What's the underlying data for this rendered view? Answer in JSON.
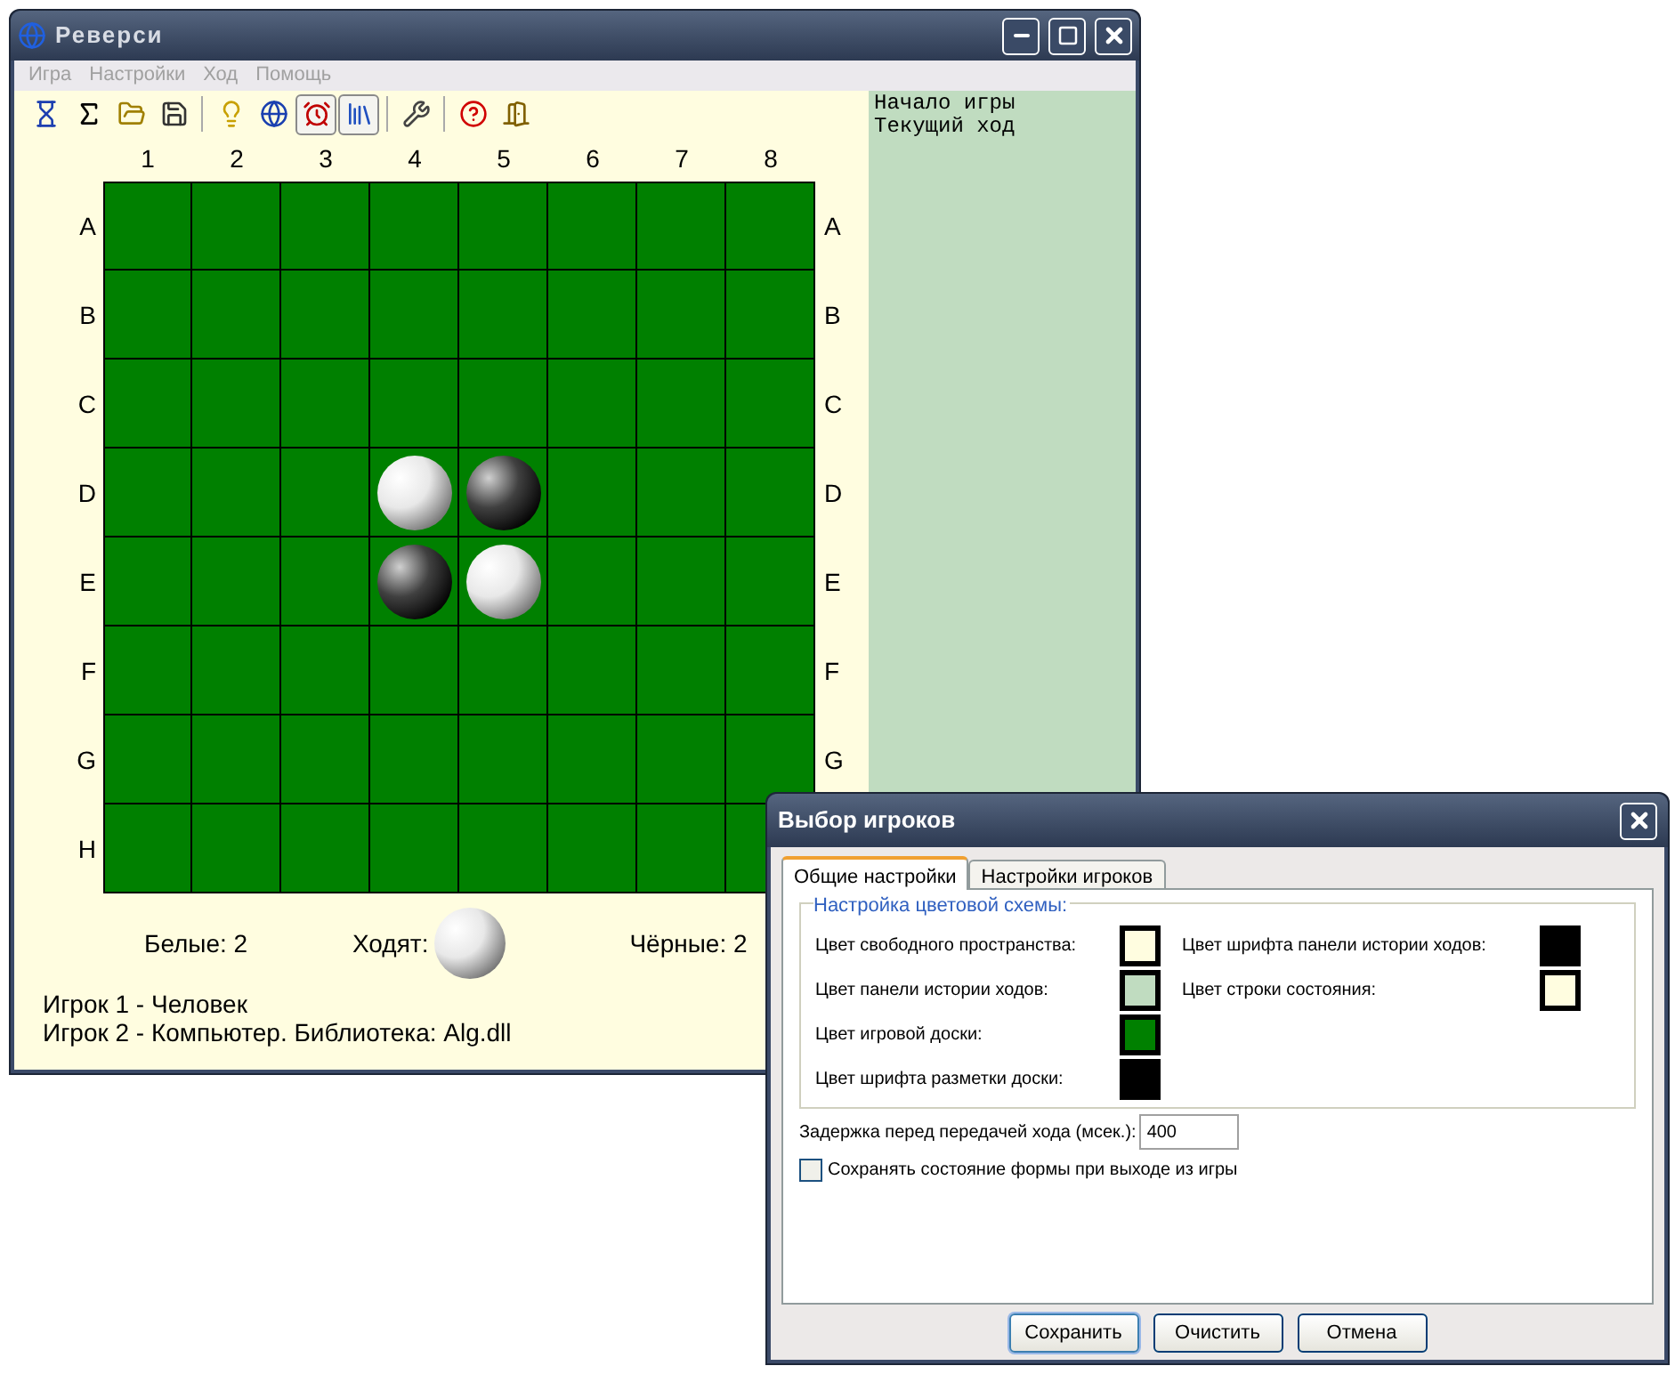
{
  "main_window": {
    "title": "Реверси"
  },
  "menu": [
    {
      "label": "Игра",
      "disabled": true
    },
    {
      "label": "Настройки",
      "disabled": true
    },
    {
      "label": "Ход",
      "disabled": true
    },
    {
      "label": "Помощь",
      "disabled": true
    }
  ],
  "toolbar": [
    {
      "kind": "hourglass",
      "pressed": false
    },
    {
      "kind": "sigma",
      "pressed": false
    },
    {
      "kind": "folder",
      "pressed": false
    },
    {
      "kind": "save",
      "pressed": false
    },
    {
      "kind": "separator"
    },
    {
      "kind": "bulb",
      "pressed": false
    },
    {
      "kind": "globe",
      "pressed": false
    },
    {
      "kind": "alarm",
      "pressed": true
    },
    {
      "kind": "books",
      "pressed": true
    },
    {
      "kind": "separator"
    },
    {
      "kind": "tools",
      "pressed": false
    },
    {
      "kind": "separator"
    },
    {
      "kind": "help",
      "pressed": false
    },
    {
      "kind": "door",
      "pressed": false
    }
  ],
  "board": {
    "columns": [
      "1",
      "2",
      "3",
      "4",
      "5",
      "6",
      "7",
      "8"
    ],
    "rows": [
      {
        "left": "A",
        "right": "A",
        "cells": [
          {
            "kind": "empty"
          },
          {
            "kind": "empty"
          },
          {
            "kind": "empty"
          },
          {
            "kind": "empty"
          },
          {
            "kind": "empty"
          },
          {
            "kind": "empty"
          },
          {
            "kind": "empty"
          },
          {
            "kind": "empty"
          }
        ]
      },
      {
        "left": "B",
        "right": "B",
        "cells": [
          {
            "kind": "empty"
          },
          {
            "kind": "empty"
          },
          {
            "kind": "empty"
          },
          {
            "kind": "empty"
          },
          {
            "kind": "empty"
          },
          {
            "kind": "empty"
          },
          {
            "kind": "empty"
          },
          {
            "kind": "empty"
          }
        ]
      },
      {
        "left": "C",
        "right": "C",
        "cells": [
          {
            "kind": "empty"
          },
          {
            "kind": "empty"
          },
          {
            "kind": "empty"
          },
          {
            "kind": "empty"
          },
          {
            "kind": "empty"
          },
          {
            "kind": "empty"
          },
          {
            "kind": "empty"
          },
          {
            "kind": "empty"
          }
        ]
      },
      {
        "left": "D",
        "right": "D",
        "cells": [
          {
            "kind": "empty"
          },
          {
            "kind": "empty"
          },
          {
            "kind": "empty"
          },
          {
            "kind": "white"
          },
          {
            "kind": "black"
          },
          {
            "kind": "empty"
          },
          {
            "kind": "empty"
          },
          {
            "kind": "empty"
          }
        ]
      },
      {
        "left": "E",
        "right": "E",
        "cells": [
          {
            "kind": "empty"
          },
          {
            "kind": "empty"
          },
          {
            "kind": "empty"
          },
          {
            "kind": "black"
          },
          {
            "kind": "white"
          },
          {
            "kind": "empty"
          },
          {
            "kind": "empty"
          },
          {
            "kind": "empty"
          }
        ]
      },
      {
        "left": "F",
        "right": "F",
        "cells": [
          {
            "kind": "empty"
          },
          {
            "kind": "empty"
          },
          {
            "kind": "empty"
          },
          {
            "kind": "empty"
          },
          {
            "kind": "empty"
          },
          {
            "kind": "empty"
          },
          {
            "kind": "empty"
          },
          {
            "kind": "empty"
          }
        ]
      },
      {
        "left": "G",
        "right": "G",
        "cells": [
          {
            "kind": "empty"
          },
          {
            "kind": "empty"
          },
          {
            "kind": "empty"
          },
          {
            "kind": "empty"
          },
          {
            "kind": "empty"
          },
          {
            "kind": "empty"
          },
          {
            "kind": "empty"
          },
          {
            "kind": "empty"
          }
        ]
      },
      {
        "left": "H",
        "cells": [
          {
            "kind": "empty"
          },
          {
            "kind": "empty"
          },
          {
            "kind": "empty"
          },
          {
            "kind": "empty"
          },
          {
            "kind": "empty"
          },
          {
            "kind": "empty"
          },
          {
            "kind": "empty"
          },
          {
            "kind": "empty"
          }
        ]
      }
    ]
  },
  "score": {
    "white": "Белые: 2",
    "turn_label": "Ходят:",
    "turn": {
      "kind": "white"
    },
    "black": "Чёрные: 2"
  },
  "players": [
    "Игрок 1 - Человек",
    "Игрок 2 - Компьютер. Библиотека: Alg.dll"
  ],
  "history": [
    "Начало игры",
    "Текущий ход"
  ],
  "dialog": {
    "title": "Выбор игроков",
    "tabs": [
      {
        "label": "Общие настройки",
        "selected": true
      },
      {
        "label": "Настройки игроков",
        "selected": false
      }
    ],
    "group_title": "Настройка цветовой схемы:",
    "colors_left": [
      {
        "label": "Цвет свободного пространства:",
        "color": "#fffde0"
      },
      {
        "label": "Цвет панели истории ходов:",
        "color": "#c0dcc0"
      },
      {
        "label": "Цвет игровой доски:",
        "color": "#008000"
      },
      {
        "label": "Цвет шрифта разметки доски:",
        "color": "#000000"
      }
    ],
    "colors_right": [
      {
        "label": "Цвет шрифта панели истории ходов:",
        "color": "#000000"
      },
      {
        "label": "Цвет строки состояния:",
        "color": "#fffde0"
      }
    ],
    "delay": {
      "label": "Задержка перед передачей хода (мсек.):",
      "value": "400"
    },
    "save_state": {
      "label": "Сохранять состояние формы при выходе из игры",
      "checked": false
    },
    "buttons": [
      {
        "label": "Сохранить",
        "default": true
      },
      {
        "label": "Очистить",
        "default": false
      },
      {
        "label": "Отмена",
        "default": false
      }
    ]
  }
}
